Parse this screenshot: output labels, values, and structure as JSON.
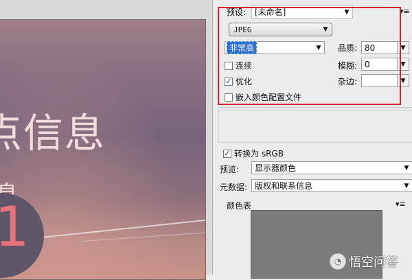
{
  "preview": {
    "title": "点信息",
    "subtitle": "息",
    "number": "1"
  },
  "settings": {
    "preset_label": "预设:",
    "preset_value": "[未命名]",
    "format_value": "JPEG",
    "quality_preset": "非常高",
    "quality_label": "品质:",
    "quality_value": "80",
    "progressive_label": "连续",
    "progressive_checked": false,
    "blur_label": "模糊:",
    "blur_value": "0",
    "optimized_label": "优化",
    "optimized_checked": true,
    "matte_label": "杂边:",
    "matte_value": "",
    "embed_profile_label": "嵌入颜色配置文件",
    "embed_profile_checked": false
  },
  "conversion": {
    "convert_label": "转换为 sRGB",
    "convert_checked": true,
    "preview_label": "预览:",
    "preview_value": "显示器颜色",
    "metadata_label": "元数据:",
    "metadata_value": "版权和联系信息"
  },
  "color_table": {
    "label": "颜色表"
  },
  "watermark": {
    "text": "悟空问答"
  },
  "icons": {
    "menu": "panel-menu-icon",
    "dropdown": "chevron-down-icon",
    "check": "checkmark-icon"
  },
  "colors": {
    "highlight": "#d7232b",
    "selection": "#2f6fd0",
    "swatch": "#7b7b7b"
  }
}
